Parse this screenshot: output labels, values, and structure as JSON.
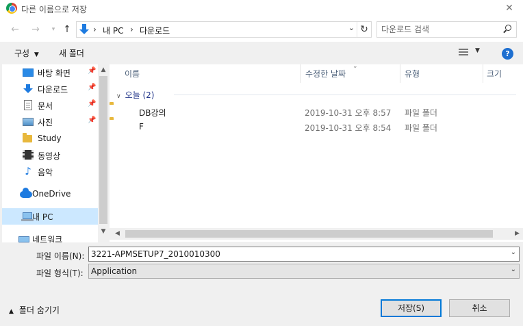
{
  "window": {
    "title": "다른 이름으로 저장"
  },
  "nav": {
    "breadcrumb": [
      "내 PC",
      "다운로드"
    ],
    "search_placeholder": "다운로드 검색"
  },
  "toolbar": {
    "organize_label": "구성",
    "new_folder_label": "새 폴더",
    "help_label": "?"
  },
  "sidebar": {
    "items": [
      {
        "label": "바탕 화면",
        "icon": "desktop-icon",
        "pinned": true
      },
      {
        "label": "다운로드",
        "icon": "download-icon",
        "pinned": true
      },
      {
        "label": "문서",
        "icon": "document-icon",
        "pinned": true
      },
      {
        "label": "사진",
        "icon": "picture-icon",
        "pinned": true
      },
      {
        "label": "Study",
        "icon": "folder-icon",
        "pinned": false
      },
      {
        "label": "동영상",
        "icon": "video-icon",
        "pinned": false
      },
      {
        "label": "음악",
        "icon": "music-icon",
        "pinned": false
      },
      {
        "label": "OneDrive",
        "icon": "cloud-icon",
        "pinned": false
      },
      {
        "label": "내 PC",
        "icon": "computer-icon",
        "pinned": false,
        "selected": true
      },
      {
        "label": "네트워크",
        "icon": "network-icon",
        "pinned": false
      }
    ]
  },
  "columns": {
    "name": "이름",
    "date": "수정한 날짜",
    "type": "유형",
    "size": "크기"
  },
  "group": {
    "label": "오늘 (2)"
  },
  "files": [
    {
      "name": "DB강의",
      "date": "2019-10-31 오후 8:57",
      "type": "파일 폴더"
    },
    {
      "name": "F",
      "date": "2019-10-31 오후 8:54",
      "type": "파일 폴더"
    }
  ],
  "form": {
    "filename_label": "파일 이름(N):",
    "filename_value": "3221-APMSETUP7_2010010300",
    "filetype_label": "파일 형식(T):",
    "filetype_value": "Application"
  },
  "footer": {
    "hide_folders_label": "폴더 숨기기",
    "save_label": "저장(S)",
    "cancel_label": "취소"
  },
  "colors": {
    "accent": "#0078d7",
    "selection": "#cce8ff",
    "folder": "#e8b83c"
  }
}
